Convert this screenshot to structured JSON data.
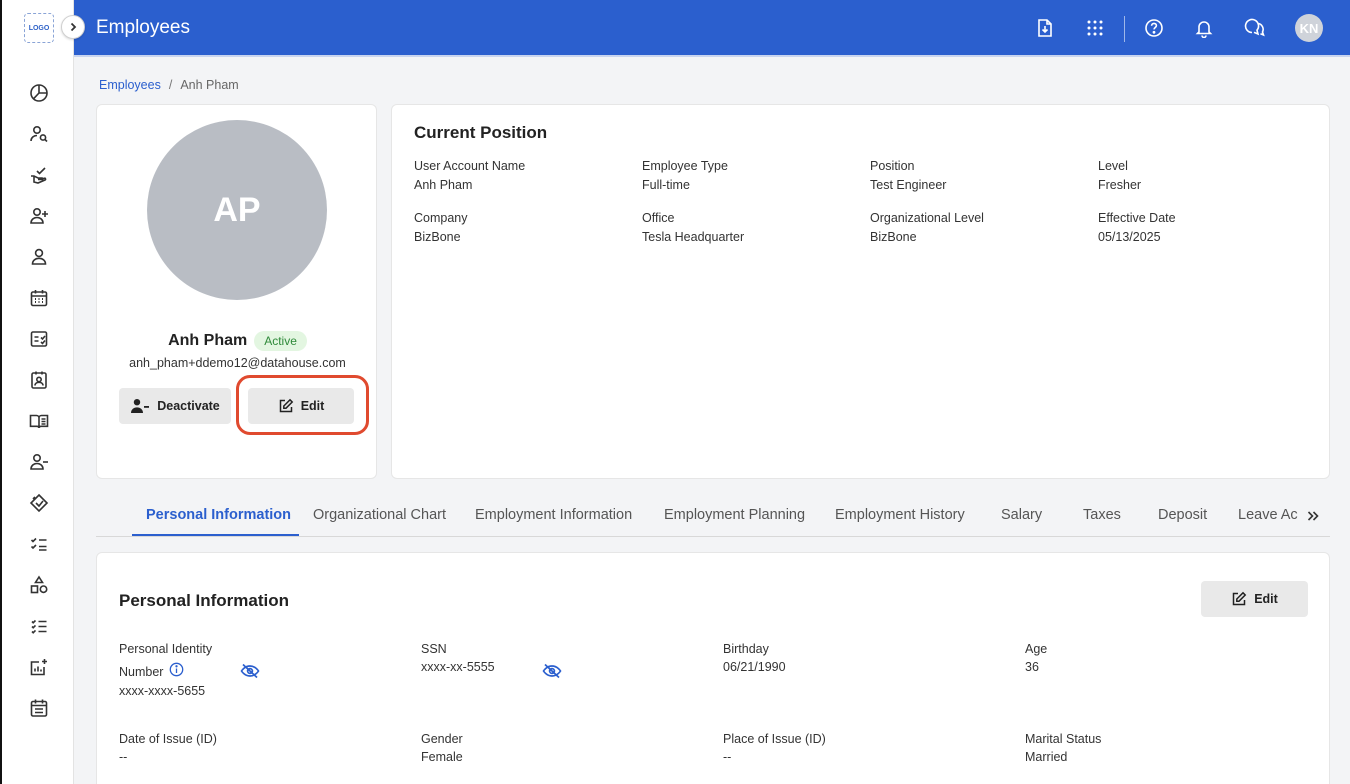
{
  "sidebar": {
    "logo_text": "LOGO",
    "collapse_icon": "chevron-right-icon",
    "items": [
      {
        "icon": "pie-chart-icon"
      },
      {
        "icon": "user-search-icon"
      },
      {
        "icon": "hand-check-icon"
      },
      {
        "icon": "user-add-icon"
      },
      {
        "icon": "user-icon"
      },
      {
        "icon": "calendar-icon"
      },
      {
        "icon": "checklist-card-icon"
      },
      {
        "icon": "contact-card-icon"
      },
      {
        "icon": "book-open-icon"
      },
      {
        "icon": "user-remove-icon"
      },
      {
        "icon": "tag-icon"
      },
      {
        "icon": "task-list-icon"
      },
      {
        "icon": "shapes-icon"
      },
      {
        "icon": "list-check-icon"
      },
      {
        "icon": "analytics-add-icon"
      },
      {
        "icon": "calendar-notes-icon"
      }
    ]
  },
  "header": {
    "title": "Employees",
    "user_initials": "KN"
  },
  "breadcrumb": {
    "parent": "Employees",
    "separator": "/",
    "current": "Anh Pham"
  },
  "profile": {
    "initials": "AP",
    "name": "Anh Pham",
    "status": "Active",
    "email": "anh_pham+ddemo12@datahouse.com",
    "deactivate_label": "Deactivate",
    "edit_label": "Edit"
  },
  "current_position": {
    "title": "Current Position",
    "fields": [
      {
        "label": "User Account Name",
        "value": "Anh Pham"
      },
      {
        "label": "Employee Type",
        "value": "Full-time"
      },
      {
        "label": "Position",
        "value": "Test Engineer"
      },
      {
        "label": "Level",
        "value": "Fresher"
      },
      {
        "label": "Company",
        "value": "BizBone"
      },
      {
        "label": "Office",
        "value": "Tesla Headquarter"
      },
      {
        "label": "Organizational Level",
        "value": "BizBone"
      },
      {
        "label": "Effective Date",
        "value": "05/13/2025"
      }
    ]
  },
  "tabs": [
    {
      "label": "Personal Information",
      "active": true
    },
    {
      "label": "Organizational Chart"
    },
    {
      "label": "Employment Information"
    },
    {
      "label": "Employment Planning"
    },
    {
      "label": "Employment History"
    },
    {
      "label": "Salary"
    },
    {
      "label": "Taxes"
    },
    {
      "label": "Deposit"
    },
    {
      "label": "Leave Ac"
    }
  ],
  "personal_info": {
    "title": "Personal Information",
    "edit_label": "Edit",
    "pid_label_line1": "Personal Identity",
    "pid_label_line2": "Number",
    "pid_value": "xxxx-xxxx-5655",
    "ssn_label": "SSN",
    "ssn_value": "xxxx-xx-5555",
    "birthday_label": "Birthday",
    "birthday_value": "06/21/1990",
    "age_label": "Age",
    "age_value": "36",
    "doi_label": "Date of Issue (ID)",
    "doi_value": "--",
    "gender_label": "Gender",
    "gender_value": "Female",
    "poi_label": "Place of Issue (ID)",
    "poi_value": "--",
    "marital_label": "Marital Status",
    "marital_value": "Married"
  }
}
